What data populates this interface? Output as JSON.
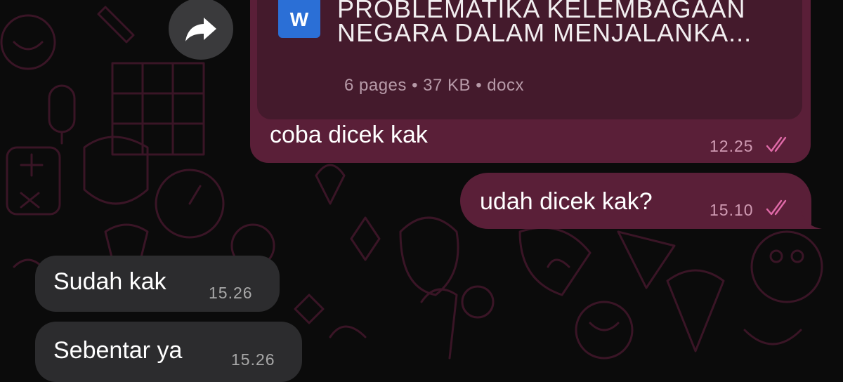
{
  "colors": {
    "outgoing_bubble": "#5a1f38",
    "document_card": "#441a2c",
    "incoming_bubble": "#2c2c2e",
    "wallpaper_lines": "#3a1526",
    "read_ticks": "#e06aa8"
  },
  "forward": {
    "icon": "forward-arrow-icon"
  },
  "document_message": {
    "file_icon_letter": "W",
    "title_line1": "PROBLEMATIKA KELEMBAGAAN",
    "title_line2": "NEGARA DALAM MENJALANKA...",
    "meta": "6 pages • 37 KB • docx",
    "caption": "coba dicek kak",
    "time": "12.25",
    "status_icon": "double-check-icon"
  },
  "messages": [
    {
      "direction": "outgoing",
      "text": "udah dicek kak?",
      "time": "15.10",
      "status_icon": "double-check-icon"
    },
    {
      "direction": "incoming",
      "text": "Sudah kak",
      "time": "15.26"
    },
    {
      "direction": "incoming",
      "text": "Sebentar ya",
      "time": "15.26"
    }
  ]
}
